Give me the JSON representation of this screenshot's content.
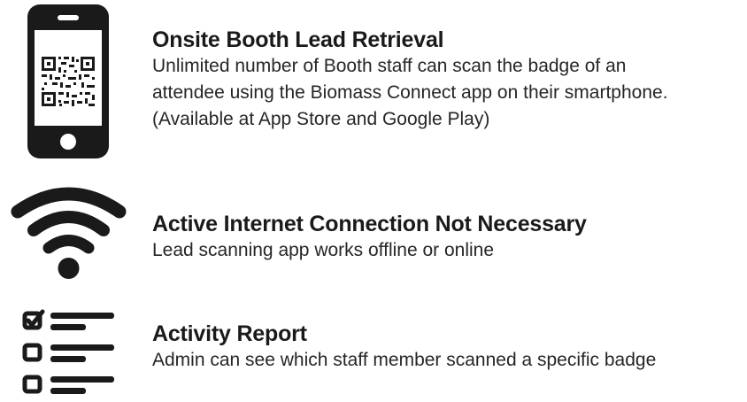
{
  "features": [
    {
      "icon": "smartphone-qr-icon",
      "title": "Onsite Booth Lead Retrieval",
      "description_lines": [
        "Unlimited number of Booth staff can scan the badge of an",
        "attendee using the Biomass Connect app on their smartphone.",
        "(Available at App Store and Google Play)"
      ]
    },
    {
      "icon": "wifi-icon",
      "title": "Active Internet Connection Not Necessary",
      "description_lines": [
        "Lead scanning app works offline or online"
      ]
    },
    {
      "icon": "checklist-icon",
      "title": "Activity Report",
      "description_lines": [
        "Admin can see which staff member scanned a specific badge"
      ]
    }
  ],
  "colors": {
    "icon": "#1a1a1a",
    "text": "#262626",
    "background": "#ffffff"
  }
}
